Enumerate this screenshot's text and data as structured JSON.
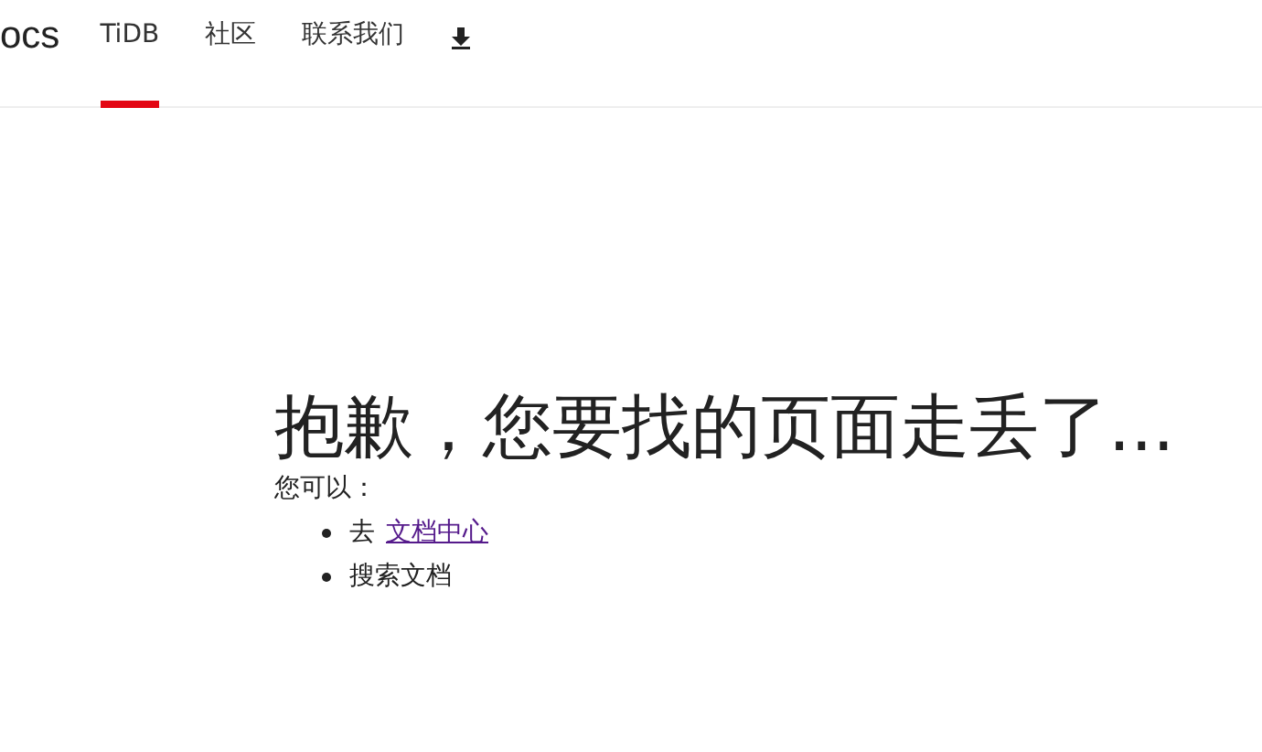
{
  "header": {
    "logo": "ocs",
    "tabs": [
      {
        "label": "TiDB",
        "selected": true
      },
      {
        "label": "社区",
        "selected": false
      },
      {
        "label": "联系我们",
        "selected": false
      }
    ]
  },
  "main": {
    "title": "抱歉，您要找的页面走丢了...",
    "intro": "您可以：",
    "options": [
      {
        "text": "去",
        "link": "文档中心"
      },
      {
        "text": "搜索文档"
      }
    ]
  }
}
